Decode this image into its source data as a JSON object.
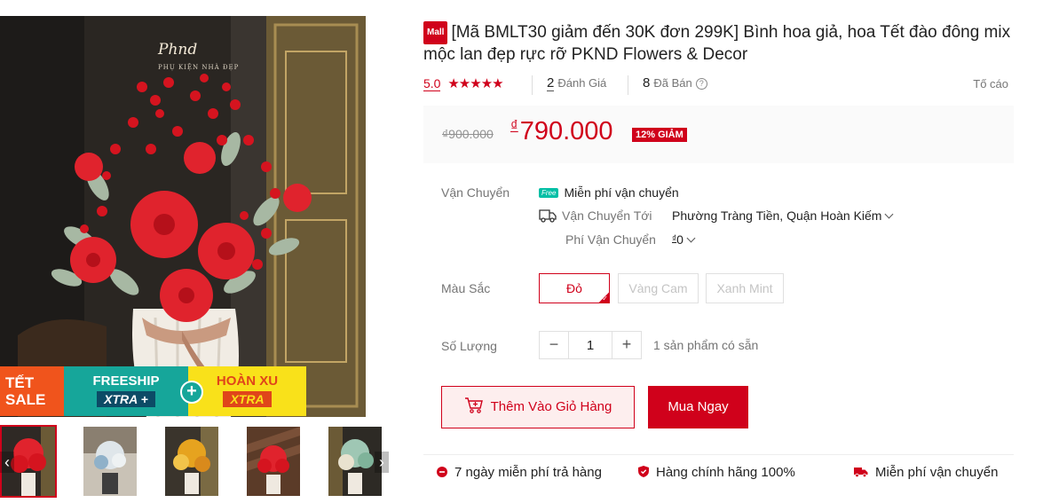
{
  "gallery": {
    "brand_name": "Phnd",
    "brand_sub": "PHỤ KIỆN NHÀ ĐẸP",
    "promo": {
      "tet_line1": "TẾT",
      "tet_line2": "SALE",
      "freeship_line1": "FREESHIP",
      "freeship_line2": "XTRA +",
      "plus": "+",
      "hoanxu_line1": "HOÀN XU",
      "hoanxu_line2": "XTRA"
    },
    "thumbnails": [
      "red-vase",
      "white-blue-vase",
      "gold-vase",
      "red-stairs-vase",
      "green-vase"
    ],
    "arrow_left": "‹",
    "arrow_right": "›"
  },
  "product": {
    "mall_badge": "Mall",
    "title": "[Mã BMLT30 giảm đến 30K đơn 299K] Bình hoa giả, hoa Tết đào đông mix mộc lan đẹp rực rỡ PKND Flowers & Decor"
  },
  "meta": {
    "rating_value": "5.0",
    "stars": "★★★★★",
    "review_count": "2",
    "review_label": "Đánh Giá",
    "sold_count": "8",
    "sold_label": "Đã Bán",
    "help_icon": "?",
    "report_label": "Tố cáo"
  },
  "price": {
    "old": "₫900.000",
    "currency": "₫",
    "current": "790.000",
    "discount": "12% GIẢM"
  },
  "shipping": {
    "label": "Vận Chuyển",
    "free_tag": "Free",
    "free_text": "Miễn phí vận chuyển",
    "to_label": "Vận Chuyển Tới",
    "to_address": "Phường Tràng Tiền, Quận Hoàn Kiếm",
    "fee_label": "Phí Vận Chuyển",
    "fee_currency": "₫",
    "fee_value": "0"
  },
  "color": {
    "label": "Màu Sắc",
    "options": [
      "Đỏ",
      "Vàng Cam",
      "Xanh Mint"
    ],
    "selected": "Đỏ"
  },
  "quantity": {
    "label": "Số Lượng",
    "minus": "−",
    "value": "1",
    "plus": "+",
    "stock": "1 sản phẩm có sẵn"
  },
  "actions": {
    "add_to_cart": "Thêm Vào Giỏ Hàng",
    "buy_now": "Mua Ngay"
  },
  "guarantees": [
    "7 ngày miễn phí trả hàng",
    "Hàng chính hãng 100%",
    "Miễn phí vận chuyển"
  ],
  "colors": {
    "accent": "#d0011b",
    "freeship_teal": "#16a69a",
    "xtra_yellow": "#f9e11a",
    "tet_orange": "#f0541c"
  }
}
